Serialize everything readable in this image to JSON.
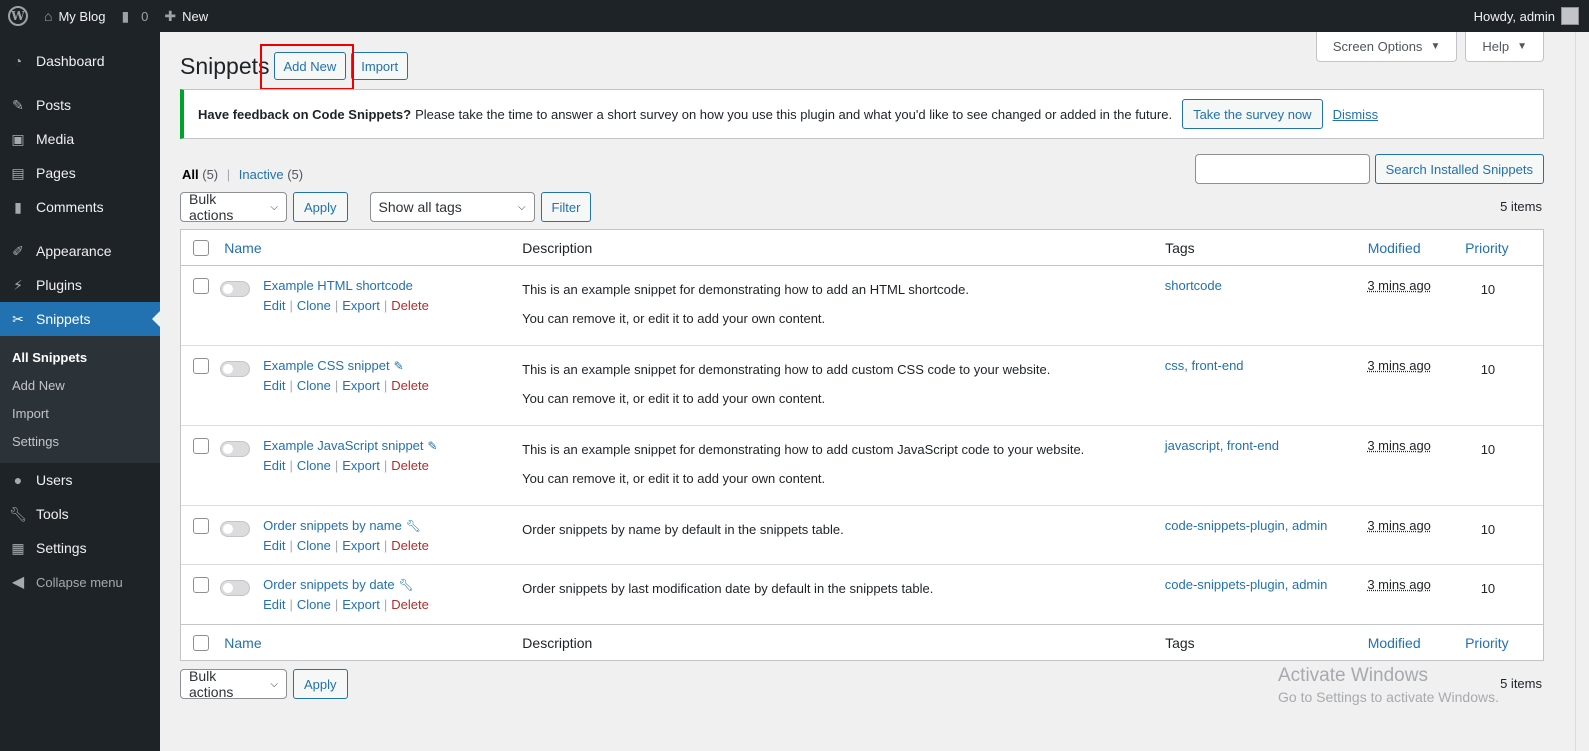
{
  "adminbar": {
    "site_name": "My Blog",
    "comments_count": "0",
    "new_label": "New",
    "howdy": "Howdy, admin"
  },
  "sidebar": {
    "items": [
      {
        "label": "Dashboard",
        "icon": "dashboard-icon"
      },
      {
        "label": "Posts",
        "icon": "pin-icon"
      },
      {
        "label": "Media",
        "icon": "media-icon"
      },
      {
        "label": "Pages",
        "icon": "pages-icon"
      },
      {
        "label": "Comments",
        "icon": "comment-icon"
      },
      {
        "label": "Appearance",
        "icon": "brush-icon"
      },
      {
        "label": "Plugins",
        "icon": "plug-icon"
      },
      {
        "label": "Snippets",
        "icon": "scissors-icon"
      },
      {
        "label": "Users",
        "icon": "user-icon"
      },
      {
        "label": "Tools",
        "icon": "wrench-icon"
      },
      {
        "label": "Settings",
        "icon": "sliders-icon"
      }
    ],
    "submenu": [
      "All Snippets",
      "Add New",
      "Import",
      "Settings"
    ],
    "collapse": "Collapse menu"
  },
  "screen_options": "Screen Options",
  "help": "Help",
  "page": {
    "title": "Snippets",
    "add_new": "Add New",
    "import": "Import"
  },
  "notice": {
    "bold": "Have feedback on Code Snippets?",
    "text": "Please take the time to answer a short survey on how you use this plugin and what you'd like to see changed or added in the future.",
    "button": "Take the survey now",
    "dismiss": "Dismiss"
  },
  "filters": {
    "all": "All",
    "all_count": "(5)",
    "inactive": "Inactive",
    "inactive_count": "(5)"
  },
  "search": {
    "button": "Search Installed Snippets"
  },
  "tablenav": {
    "bulk_actions": "Bulk actions",
    "apply": "Apply",
    "tags_select": "Show all tags",
    "filter": "Filter",
    "items": "5 items"
  },
  "table": {
    "headers": {
      "name": "Name",
      "description": "Description",
      "tags": "Tags",
      "modified": "Modified",
      "priority": "Priority"
    },
    "row_actions": {
      "edit": "Edit",
      "clone": "Clone",
      "export": "Export",
      "delete": "Delete"
    },
    "rows": [
      {
        "name": "Example HTML shortcode",
        "desc1": "This is an example snippet for demonstrating how to add an HTML shortcode.",
        "desc2": "You can remove it, or edit it to add your own content.",
        "tags": "shortcode",
        "modified": "3 mins ago",
        "priority": "10"
      },
      {
        "name": "Example CSS snippet",
        "desc1": "This is an example snippet for demonstrating how to add custom CSS code to your website.",
        "desc2": "You can remove it, or edit it to add your own content.",
        "tags": "css, front-end",
        "modified": "3 mins ago",
        "priority": "10"
      },
      {
        "name": "Example JavaScript snippet",
        "desc1": "This is an example snippet for demonstrating how to add custom JavaScript code to your website.",
        "desc2": "You can remove it, or edit it to add your own content.",
        "tags": "javascript, front-end",
        "modified": "3 mins ago",
        "priority": "10"
      },
      {
        "name": "Order snippets by name",
        "desc1": "Order snippets by name by default in the snippets table.",
        "tags": "code-snippets-plugin, admin",
        "modified": "3 mins ago",
        "priority": "10"
      },
      {
        "name": "Order snippets by date",
        "desc1": "Order snippets by last modification date by default in the snippets table.",
        "tags": "code-snippets-plugin, admin",
        "modified": "3 mins ago",
        "priority": "10"
      }
    ]
  },
  "watermark": {
    "line1": "Activate Windows",
    "line2": "Go to Settings to activate Windows."
  },
  "colors": {
    "accent": "#2271b1",
    "sidebar": "#1d2327",
    "notice_border": "#00a32a",
    "highlight": "#ee0000"
  }
}
